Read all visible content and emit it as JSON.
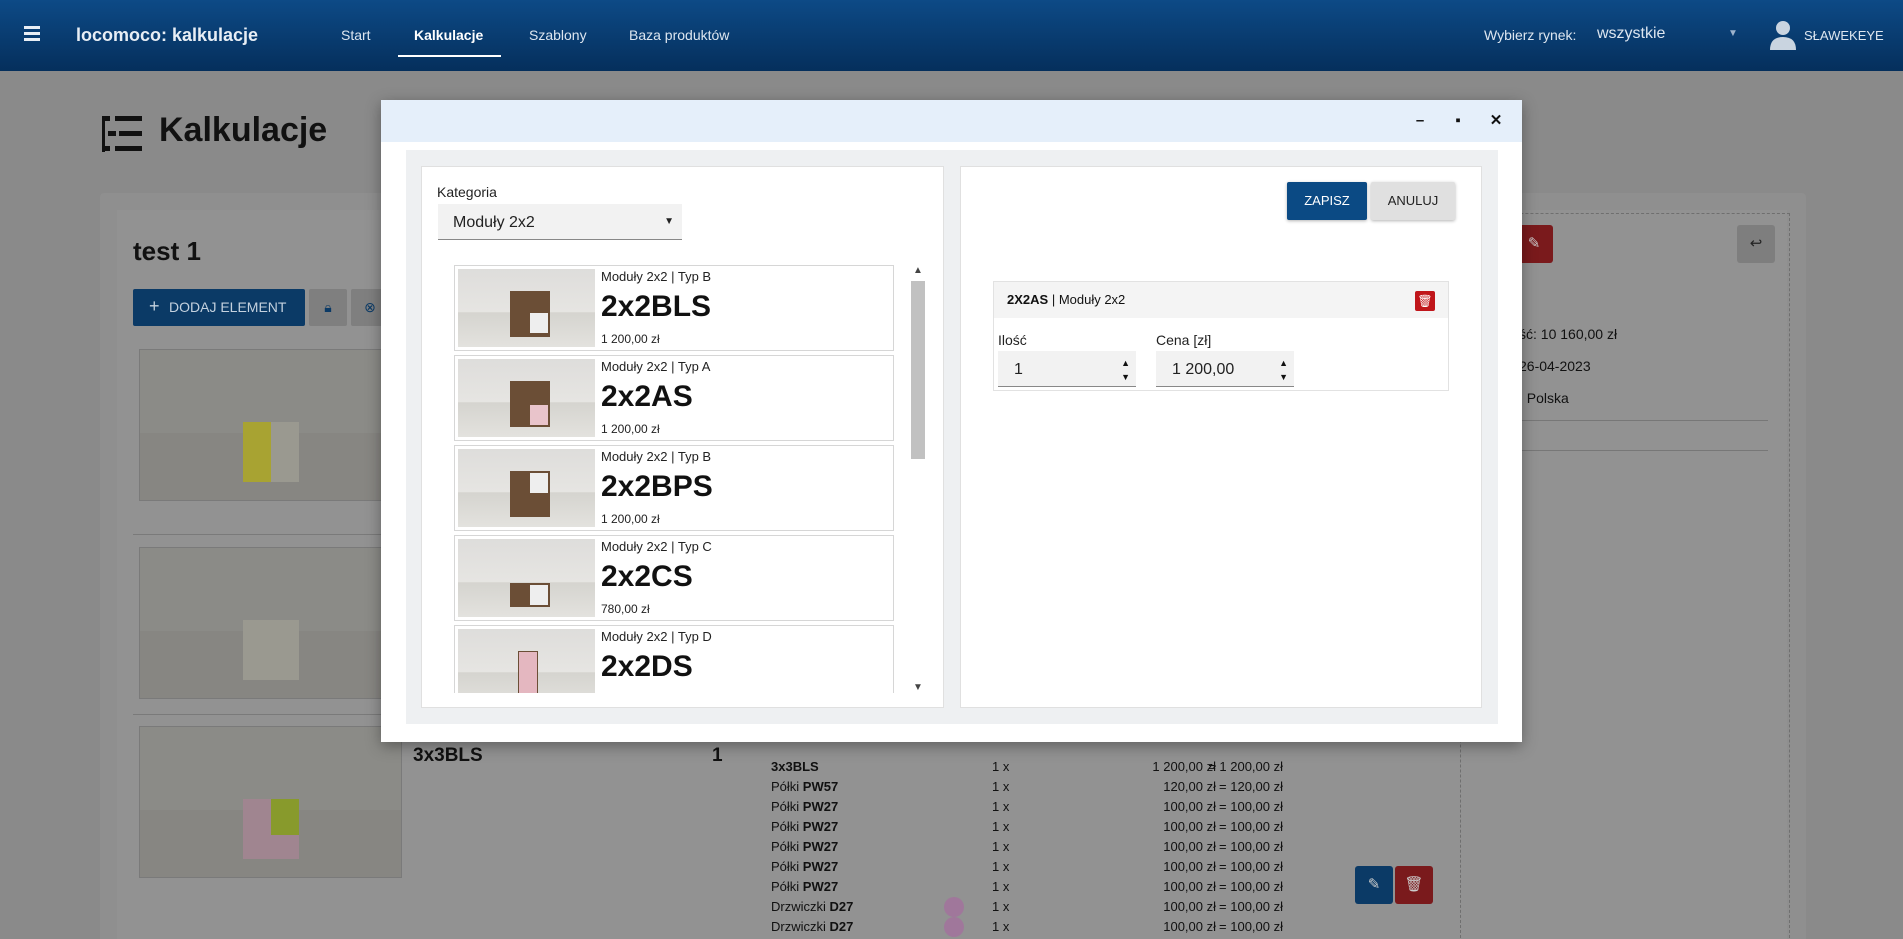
{
  "topbar": {
    "brand": "locomoco: kalkulacje",
    "nav": [
      "Start",
      "Kalkulacje",
      "Szablony",
      "Baza produktów"
    ],
    "market_label": "Wybierz rynek:",
    "market_value": "wszystkie",
    "user": "SŁAWEKEYE"
  },
  "page": {
    "title": "Kalkulacje",
    "calc_title": "test 1",
    "add_button": "DODAJ ELEMENT"
  },
  "background_item": {
    "name": "3x3BLS",
    "qty": "1",
    "details": [
      {
        "name_prefix": "",
        "name_bold": "3x3BLS",
        "qty": "1 x",
        "price": "1 200,00 zł",
        "total": "= 1 200,00 zł"
      },
      {
        "name_prefix": "Półki ",
        "name_bold": "PW57",
        "qty": "1 x",
        "price": "120,00 zł",
        "total": "= 120,00 zł"
      },
      {
        "name_prefix": "Półki ",
        "name_bold": "PW27",
        "qty": "1 x",
        "price": "100,00 zł",
        "total": "= 100,00 zł"
      },
      {
        "name_prefix": "Półki ",
        "name_bold": "PW27",
        "qty": "1 x",
        "price": "100,00 zł",
        "total": "= 100,00 zł"
      },
      {
        "name_prefix": "Półki ",
        "name_bold": "PW27",
        "qty": "1 x",
        "price": "100,00 zł",
        "total": "= 100,00 zł"
      },
      {
        "name_prefix": "Półki ",
        "name_bold": "PW27",
        "qty": "1 x",
        "price": "100,00 zł",
        "total": "= 100,00 zł"
      },
      {
        "name_prefix": "Półki ",
        "name_bold": "PW27",
        "qty": "1 x",
        "price": "100,00 zł",
        "total": "= 100,00 zł"
      },
      {
        "name_prefix": "Drzwiczki ",
        "name_bold": "D27",
        "qty": "1 x",
        "price": "100,00 zł",
        "total": "= 100,00 zł"
      },
      {
        "name_prefix": "Drzwiczki ",
        "name_bold": "D27",
        "qty": "1 x",
        "price": "100,00 zł",
        "total": "= 100,00 zł"
      }
    ]
  },
  "summary": {
    "value_line": "ść: 10 160,00 zł",
    "date_line": "26-04-2023",
    "market_line": ": Polska",
    "extra_line": ":"
  },
  "modal": {
    "category_label": "Kategoria",
    "category_value": "Moduły 2x2",
    "products": [
      {
        "category": "Moduły 2x2 | Typ B",
        "code": "2x2BLS",
        "price": "1 200,00 zł"
      },
      {
        "category": "Moduły 2x2 | Typ A",
        "code": "2x2AS",
        "price": "1 200,00 zł"
      },
      {
        "category": "Moduły 2x2 | Typ B",
        "code": "2x2BPS",
        "price": "1 200,00 zł"
      },
      {
        "category": "Moduły 2x2 | Typ C",
        "code": "2x2CS",
        "price": "780,00 zł"
      },
      {
        "category": "Moduły 2x2 | Typ D",
        "code": "2x2DS",
        "price": ""
      }
    ],
    "save_label": "ZAPISZ",
    "cancel_label": "ANULUJ",
    "selected": {
      "code": "2X2AS",
      "sep": " | ",
      "category": "Moduły 2x2",
      "qty_label": "Ilość",
      "qty_value": "1",
      "price_label": "Cena [zł]",
      "price_value": "1 200,00"
    }
  },
  "colors": {
    "primary": "#0b4a84",
    "danger": "#c0161b",
    "overlay": "#8a8a8a"
  }
}
